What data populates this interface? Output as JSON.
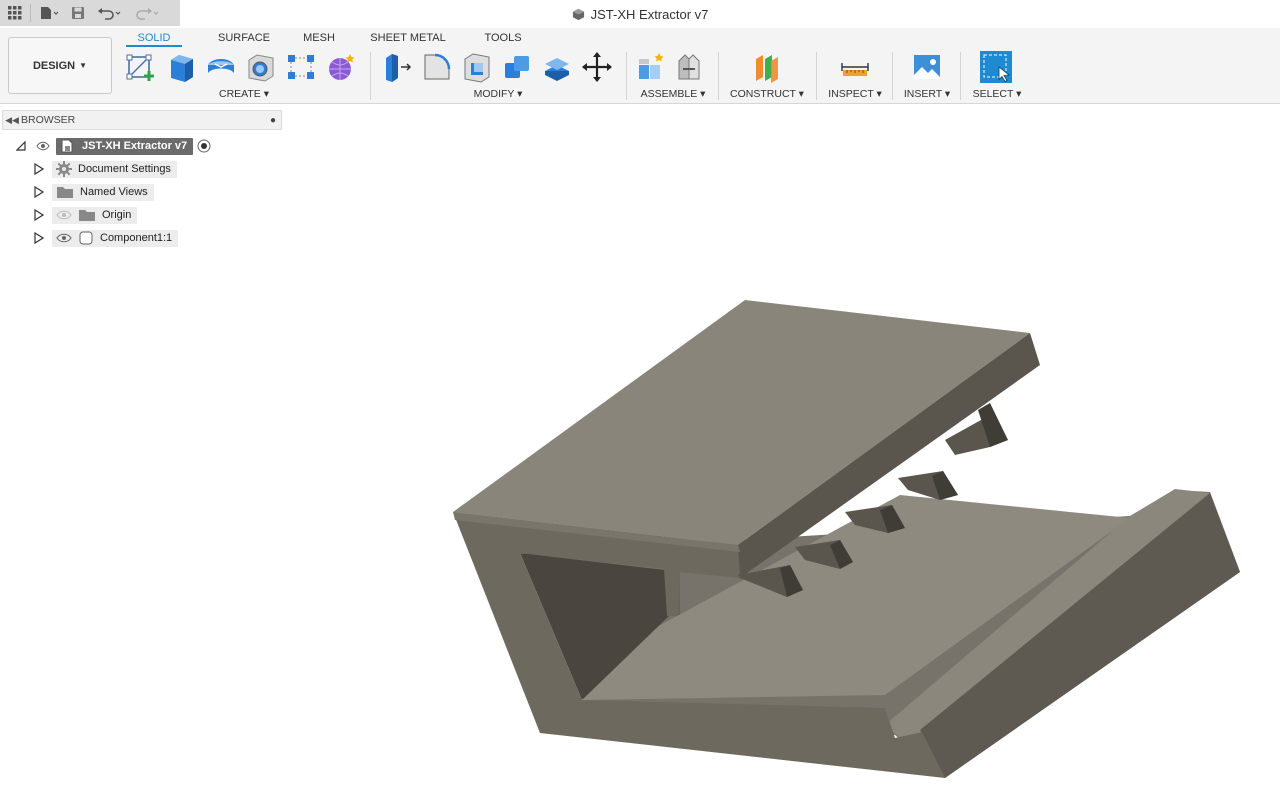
{
  "window": {
    "title": "JST-XH Extractor v7"
  },
  "workspace": {
    "label": "DESIGN"
  },
  "tabs": [
    {
      "label": "SOLID",
      "active": true
    },
    {
      "label": "SURFACE",
      "active": false
    },
    {
      "label": "MESH",
      "active": false
    },
    {
      "label": "SHEET METAL",
      "active": false
    },
    {
      "label": "TOOLS",
      "active": false
    }
  ],
  "groups": {
    "create": "CREATE ▾",
    "modify": "MODIFY ▾",
    "assemble": "ASSEMBLE ▾",
    "construct": "CONSTRUCT ▾",
    "inspect": "INSPECT ▾",
    "insert": "INSERT ▾",
    "select": "SELECT ▾"
  },
  "browser": {
    "title": "BROWSER",
    "root": "JST-XH Extractor v7",
    "items": [
      {
        "label": "Document Settings",
        "icon": "gear-icon"
      },
      {
        "label": "Named Views",
        "icon": "folder-icon"
      },
      {
        "label": "Origin",
        "icon": "folder-icon"
      },
      {
        "label": "Component1:1",
        "icon": "component-icon"
      }
    ]
  },
  "colors": {
    "accent": "#1d8ad1",
    "model_top": "#8a857a",
    "model_front": "#6e695f",
    "model_side": "#5a564d"
  }
}
